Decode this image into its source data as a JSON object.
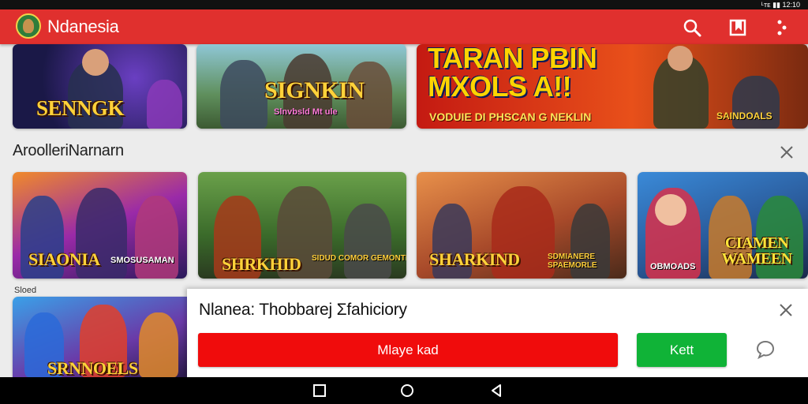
{
  "status_bar": {
    "right_text": "ᴸᴛᴇ ▮▮ 12:10"
  },
  "app_bar": {
    "title": "Ndanesia",
    "icons": [
      "search-icon",
      "bookmark-icon",
      "more-icon"
    ],
    "color": "#e0302e"
  },
  "banner_row": [
    {
      "title": "SENNGK",
      "subtitle": ""
    },
    {
      "title": "SIGNKIN",
      "subtitle": "Slnvbsld Mt ule"
    },
    {
      "title": "TARAN PBIN\nMXOLS A!!",
      "subtitle": "VODUIE DI PHSCAN G NEKLIN",
      "badge": "SAINDOALS"
    }
  ],
  "section": {
    "title": "AroolleriNarnarn",
    "close_icon": "close-icon"
  },
  "games_row": [
    {
      "title": "SIAONIA",
      "subtitle": "SMOSUSAMAN"
    },
    {
      "title": "SHRKHID",
      "subtitle": "SIDUD COMOR GEMONTHIE"
    },
    {
      "title": "SHARKIND",
      "subtitle": "SDMIANERE SPAEMORLE"
    },
    {
      "title": "CIAMEN WAMEEN",
      "subtitle": "OBMOADS"
    }
  ],
  "third_row": {
    "label": "Sloed",
    "tile_title": "SRNNOELS"
  },
  "dialog": {
    "title": "Nlanea: Thobbarej Ʃfahiciory",
    "primary_button": "Mlaye kad",
    "secondary_button": "Kett",
    "close_icon": "close-icon",
    "chat_icon": "chat-bubble-icon",
    "primary_color": "#f00c0c",
    "secondary_color": "#10b337"
  },
  "nav_bar": {
    "buttons": [
      "recents-icon",
      "home-icon",
      "back-icon"
    ]
  }
}
